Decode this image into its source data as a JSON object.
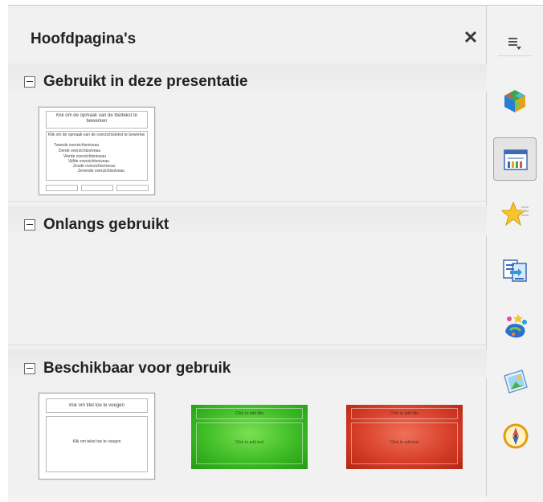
{
  "panel": {
    "title": "Hoofdpagina's",
    "close_symbol": "✕"
  },
  "sections": [
    {
      "label": "Gebruikt in deze presentatie"
    },
    {
      "label": "Onlangs gebruikt"
    },
    {
      "label": "Beschikbaar voor gebruik"
    }
  ],
  "used_thumbnail": {
    "title_text": "Klik om de opmaak van de titeltekst te bewerken",
    "body_lines": [
      "Klik om de opmaak van de overzichtstekst te bewerken",
      "Tweede overzichtsniveau",
      "Derde overzichtsniveau",
      "Vierde overzichtsniveau",
      "Vijfde overzichtsniveau",
      "Zesde overzichtsniveau",
      "Zevende overzichtsniveau"
    ]
  },
  "available_thumbnails": [
    {
      "style": "white",
      "title_text": "Klik om titel toe te voegen",
      "body_text": "Klik om tekst toe te voegen"
    },
    {
      "style": "green",
      "title_text": "Click to add title",
      "body_text": "Click to add text"
    },
    {
      "style": "red",
      "title_text": "Click to add title",
      "body_text": "Click to add text"
    }
  ],
  "sidebar": {
    "menu_icon": "sidebar-menu-icon",
    "buttons": [
      {
        "icon": "properties-icon",
        "active": false
      },
      {
        "icon": "master-slides-icon",
        "active": true
      },
      {
        "icon": "animation-icon",
        "active": false
      },
      {
        "icon": "slide-transition-icon",
        "active": false
      },
      {
        "icon": "styles-icon",
        "active": false
      },
      {
        "icon": "gallery-icon",
        "active": false
      },
      {
        "icon": "navigator-icon",
        "active": false
      }
    ]
  },
  "colors": {
    "panel_bg": "#f1f1f1",
    "section_band": "#e9e9e9",
    "active_button": "#e4e4e4"
  }
}
